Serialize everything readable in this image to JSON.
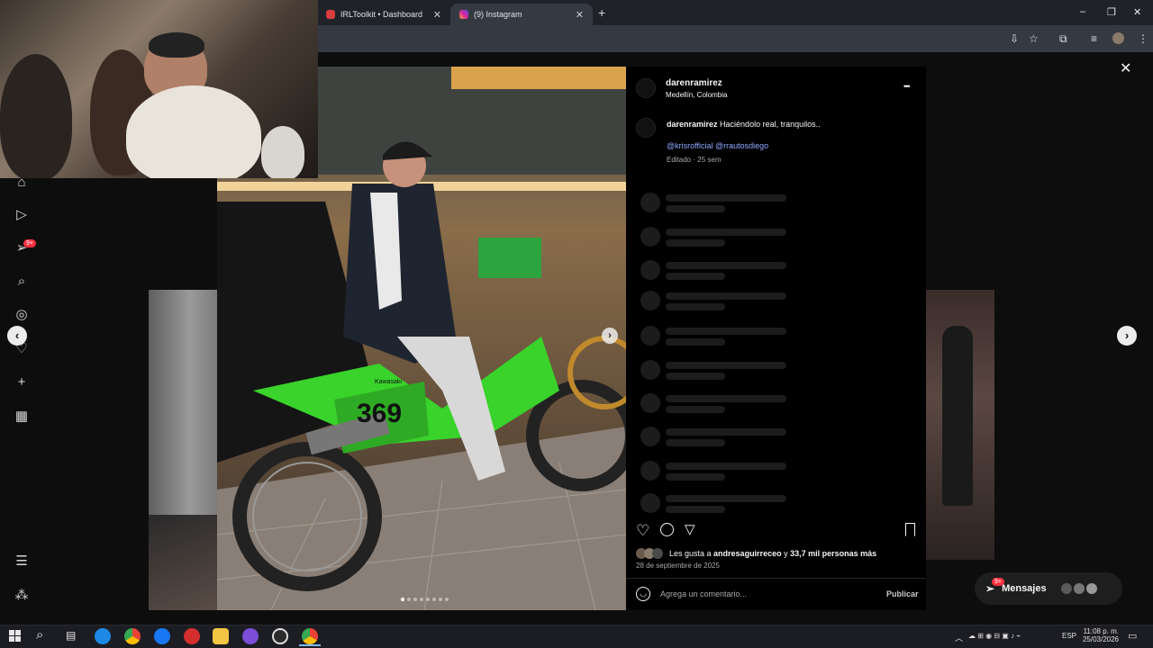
{
  "browser": {
    "tabs": [
      {
        "label": "IRLToolkit • Dashboard",
        "icon": "irltoolkit-icon",
        "color": "#d93d3d"
      },
      {
        "label": "(9) Instagram",
        "icon": "instagram-icon",
        "color": "#d6249f"
      }
    ],
    "new_tab": "+",
    "window_controls": [
      "–",
      "❐",
      "✕"
    ]
  },
  "post": {
    "username": "darenramirez",
    "location": "Medellín, Colombia",
    "caption_user": "darenramirez",
    "caption_text": "Haciéndolo real, tranquilos..",
    "mentions": "@krisrofficial @rrautosdiego",
    "edited": "Editado · 25 sem",
    "likes_prefix": "Les gusta a ",
    "likes_user": "andresaguirreceo",
    "likes_mid": " y ",
    "likes_count": "33,7 mil personas más",
    "date": "28 de septiembre de 2025",
    "comment_placeholder": "Agrega un comentario...",
    "publish": "Publicar",
    "more": "•••",
    "bike_number": "369",
    "brand": "Kawasaki",
    "carousel_dots": 8
  },
  "close": "✕",
  "sidebar": {
    "badge": "9+"
  },
  "messages": {
    "label": "Mensajes",
    "badge": "9+"
  },
  "taskbar": {
    "lang": "ESP",
    "time": "11:08 p. m.",
    "date": "25/03/2026"
  },
  "colors": {
    "accent_link": "#8fa8ff",
    "bike_green": "#39d32b",
    "badge_red": "#ff3040"
  }
}
